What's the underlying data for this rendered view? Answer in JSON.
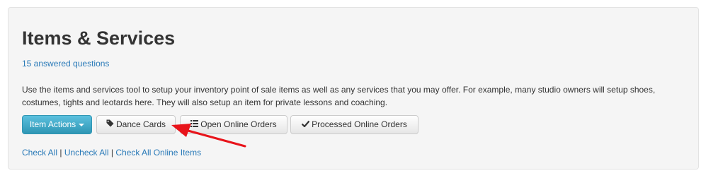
{
  "header": {
    "title": "Items & Services",
    "answered_link": "15 answered questions"
  },
  "description": "Use the items and services tool to setup your inventory point of sale items as well as any services that you may offer. For example, many studio owners will setup shoes, costumes, tights and leotards here. They will also setup an item for private lessons and coaching.",
  "toolbar": {
    "item_actions_label": "Item Actions",
    "dance_cards_label": "Dance Cards",
    "open_orders_label": "Open Online Orders",
    "processed_orders_label": "Processed Online Orders"
  },
  "selection_links": {
    "check_all": "Check All",
    "uncheck_all": "Uncheck All",
    "check_all_online": "Check All Online Items",
    "separator": "|"
  },
  "icons": {
    "dance_cards": "tag-icon",
    "open_orders": "list-icon",
    "processed_orders": "checkmark-icon",
    "item_actions": "caret-down-icon",
    "annotation": "red-arrow-icon"
  },
  "colors": {
    "panel_bg": "#f5f5f5",
    "link": "#2a7ab8",
    "primary_button": "#2f96b4",
    "annotation_arrow": "#e8141b"
  }
}
